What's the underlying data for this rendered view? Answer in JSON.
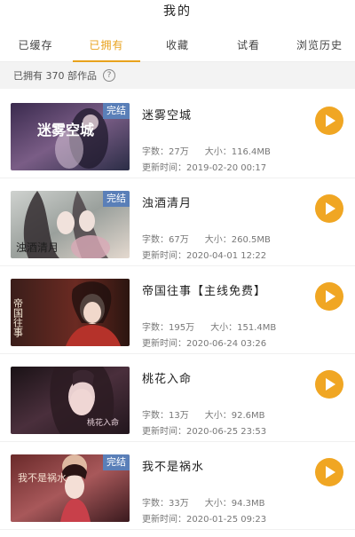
{
  "header": {
    "title": "我的"
  },
  "tabs": [
    {
      "label": "已缓存",
      "active": false
    },
    {
      "label": "已拥有",
      "active": true
    },
    {
      "label": "收藏",
      "active": false
    },
    {
      "label": "试看",
      "active": false
    },
    {
      "label": "浏览历史",
      "active": false
    }
  ],
  "summary": {
    "text": "已拥有 370 部作品",
    "help_icon": "?"
  },
  "labels": {
    "word_count": "字数：",
    "size": "大小：",
    "updated": "更新时间："
  },
  "colors": {
    "accent": "#e8a21c",
    "play_button": "#f0a623",
    "badge": "#5a7fb8"
  },
  "books": [
    {
      "title": "迷雾空城",
      "badge": "完结",
      "cover_text": "迷雾空城",
      "words": "27万",
      "size": "116.4MB",
      "updated": "2019-02-20 00:17"
    },
    {
      "title": "浊酒清月",
      "badge": "完结",
      "cover_text": "浊酒清月",
      "words": "67万",
      "size": "260.5MB",
      "updated": "2020-04-01 12:22"
    },
    {
      "title": "帝国往事【主线免费】",
      "badge": "",
      "cover_text": "帝国往事",
      "words": "195万",
      "size": "151.4MB",
      "updated": "2020-06-24 03:26"
    },
    {
      "title": "桃花入命",
      "badge": "",
      "cover_text": "桃花入命",
      "words": "13万",
      "size": "92.6MB",
      "updated": "2020-06-25 23:53"
    },
    {
      "title": "我不是祸水",
      "badge": "完结",
      "cover_text": "我不是祸水",
      "words": "33万",
      "size": "94.3MB",
      "updated": "2020-01-25 09:23"
    }
  ]
}
